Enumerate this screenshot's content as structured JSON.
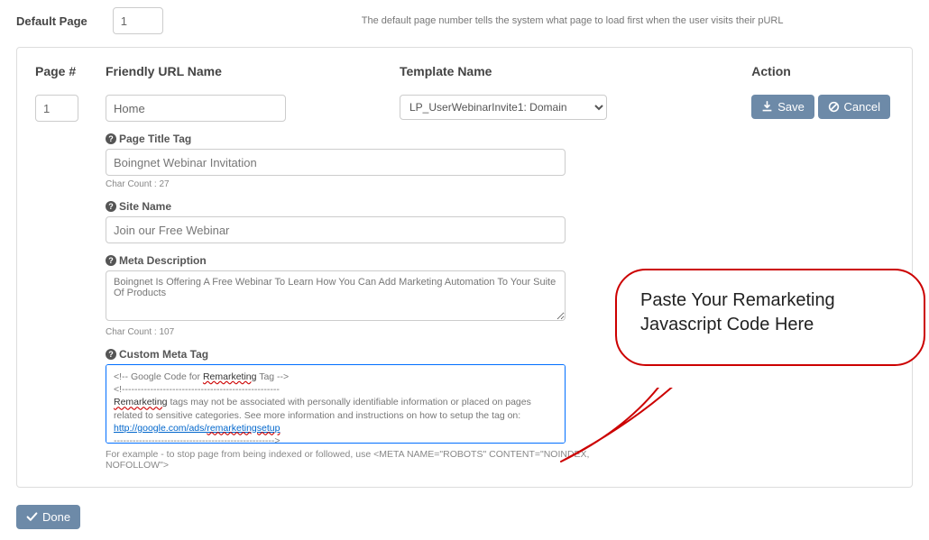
{
  "top": {
    "label": "Default Page",
    "value": "1",
    "help": "The default page number tells the system what page to load first when the user visits their pURL"
  },
  "headers": {
    "page": "Page #",
    "friendly": "Friendly URL Name",
    "template": "Template Name",
    "action": "Action"
  },
  "row": {
    "page_number": "1",
    "friendly_name": "Home",
    "template_selected": "LP_UserWebinarInvite1: Domain"
  },
  "buttons": {
    "save": "Save",
    "cancel": "Cancel",
    "done": "Done"
  },
  "sections": {
    "page_title": {
      "label": "Page Title Tag",
      "value": "Boingnet Webinar Invitation",
      "char_count": "Char Count : 27"
    },
    "site_name": {
      "label": "Site Name",
      "value": "Join our Free Webinar"
    },
    "meta_desc": {
      "label": "Meta Description",
      "value": "Boingnet Is Offering A Free Webinar To Learn How You Can Add Marketing Automation To Your Suite Of Products",
      "char_count": "Char Count : 107"
    },
    "custom_meta": {
      "label": "Custom Meta Tag",
      "line1a": "<!-- Google Code for ",
      "line1b": "Remarketing",
      "line1c": " Tag -->",
      "dashes": "<!--------------------------------------------------",
      "body1a": "Remarketing",
      "body1b": " tags may not be associated with personally identifiable information or placed on pages related to sensitive categories. See more information and instructions on how to setup the tag on: ",
      "link_pre": "http://google.com/ads/",
      "link_red": "remarketingsetup",
      "dashes2": "--------------------------------------------------->"
    }
  },
  "example_note": "For example - to stop page from being indexed or followed, use <META NAME=\"ROBOTS\" CONTENT=\"NOINDEX, NOFOLLOW\">",
  "callout": {
    "line1": "Paste Your Remarketing",
    "line2": "Javascript Code Here"
  }
}
